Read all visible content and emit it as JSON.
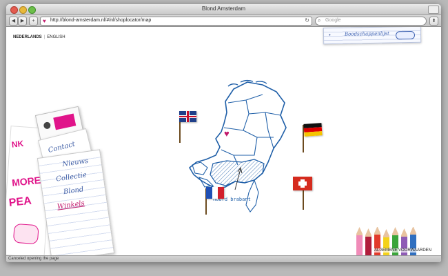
{
  "window": {
    "title": "Blond Amsterdam",
    "url": "http://blond-amsterdam.nl/#/nl/shoplocator/map",
    "search_placeholder": "Google",
    "status": "Canceled opening the page"
  },
  "language": {
    "active": "NEDERLANDS",
    "other": "ENGLISH"
  },
  "bookmark": {
    "label": "Boodschappenlijst"
  },
  "menu": {
    "contact": "Contact",
    "items": [
      "Nieuws",
      "Collectie",
      "Blond",
      "Winkels"
    ],
    "active": "Winkels"
  },
  "map": {
    "region_label": "noord brabant",
    "flags": [
      "united-kingdom-flag",
      "germany-flag",
      "france-flag",
      "switzerland-flag"
    ]
  },
  "footer": {
    "link": "ALGEMENE VOORWAARDEN"
  },
  "colors": {
    "accent": "#c2186b",
    "map_line": "#1f5fa8",
    "menu_text": "#3f5ea6"
  }
}
